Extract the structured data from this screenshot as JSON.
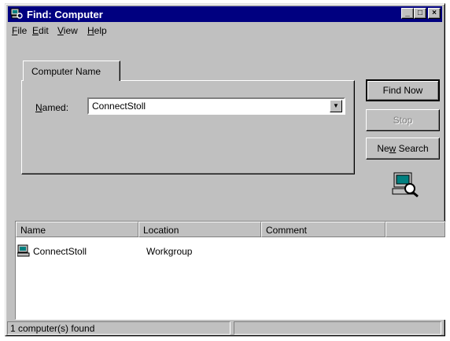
{
  "window": {
    "title": "Find: Computer",
    "controls": {
      "minimize": "_",
      "maximize": "□",
      "close": "×"
    }
  },
  "menu": {
    "file": {
      "hot": "F",
      "rest": "ile"
    },
    "edit": {
      "hot": "E",
      "rest": "dit"
    },
    "view": {
      "hot": "V",
      "rest": "iew"
    },
    "help": {
      "hot": "H",
      "rest": "elp"
    }
  },
  "tab": {
    "label": "Computer Name"
  },
  "search": {
    "named_hot": "N",
    "named_rest": "amed:",
    "value": "ConnectStoll"
  },
  "buttons": {
    "find_now": "Find Now",
    "stop": "Stop",
    "new_search_pre": "Ne",
    "new_search_hot": "w",
    "new_search_post": " Search"
  },
  "results": {
    "columns": [
      "Name",
      "Location",
      "Comment",
      ""
    ],
    "rows": [
      {
        "name": "ConnectStoll",
        "location": "Workgroup",
        "comment": ""
      }
    ]
  },
  "status": {
    "text": "1 computer(s) found"
  },
  "icons": {
    "title": "computer-search-icon",
    "row": "computer-icon",
    "animation": "magnifier-computer-icon"
  }
}
